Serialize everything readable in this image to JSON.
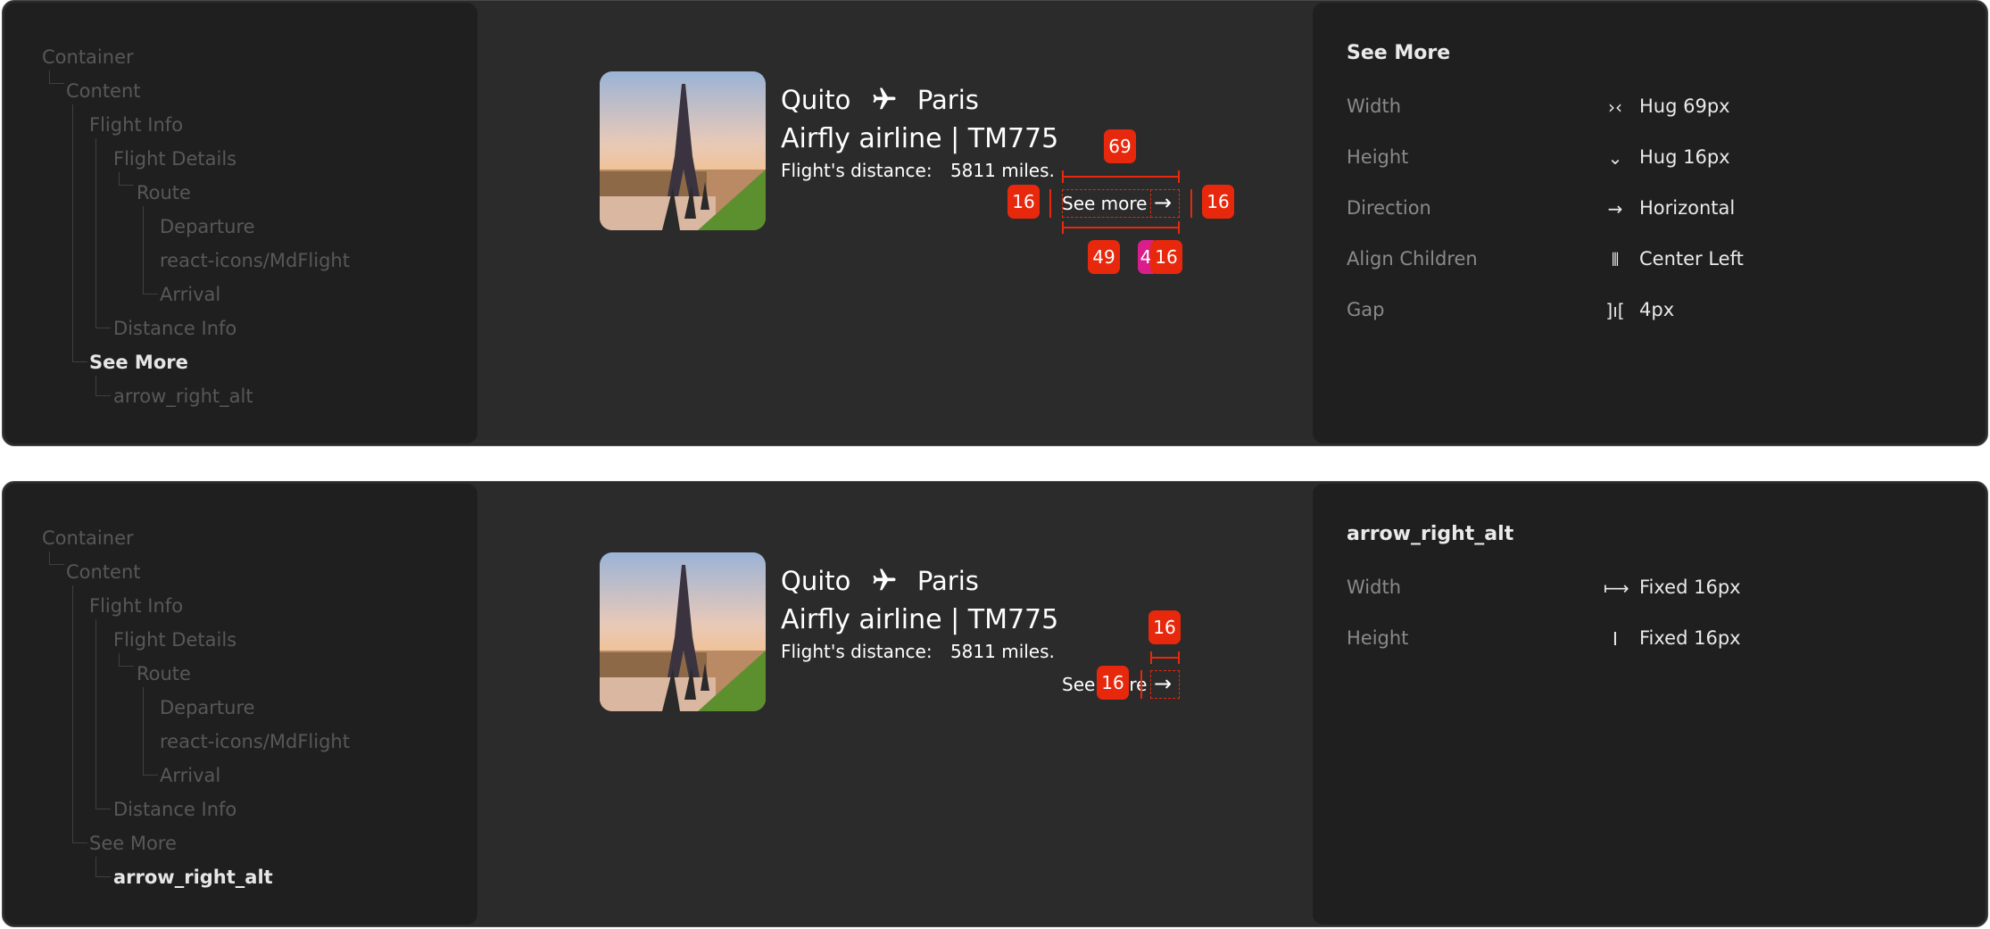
{
  "tree": {
    "items": [
      "Container",
      "Content",
      "Flight Info",
      "Flight Details",
      "Route",
      "Departure",
      "react-icons/MdFlight",
      "Arrival",
      "Distance Info",
      "See More",
      "arrow_right_alt"
    ]
  },
  "card": {
    "departure": "Quito",
    "arrival": "Paris",
    "airline": "Airfly airline | TM775",
    "distance_label": "Flight's distance:",
    "distance_value": "5811 miles.",
    "see_more": "See more",
    "flight_icon": "airplane-icon",
    "arrow_icon": "arrow-right-icon"
  },
  "panel1": {
    "selected": "See More",
    "measurements": {
      "width": "69",
      "left_padding": "16",
      "right_padding": "16",
      "text_width": "49",
      "gap": "4",
      "icon_width": "16"
    },
    "props": [
      {
        "label": "Width",
        "icon": "hug-horizontal-icon",
        "value": "Hug  69px"
      },
      {
        "label": "Height",
        "icon": "hug-vertical-icon",
        "value": "Hug  16px"
      },
      {
        "label": "Direction",
        "icon": "arrow-right-icon",
        "value": "Horizontal"
      },
      {
        "label": "Align Children",
        "icon": "align-center-left-icon",
        "value": "Center Left"
      },
      {
        "label": "Gap",
        "icon": "gap-icon",
        "value": "4px"
      }
    ]
  },
  "panel2": {
    "selected": "arrow_right_alt",
    "measurements": {
      "width": "16",
      "height": "16"
    },
    "props": [
      {
        "label": "Width",
        "icon": "fixed-width-icon",
        "value": "Fixed  16px"
      },
      {
        "label": "Height",
        "icon": "fixed-height-icon",
        "value": "Fixed  16px"
      }
    ]
  },
  "colors": {
    "accent": "#e8280c",
    "background": "#2b2b2b",
    "panel": "#1f1f1f",
    "gap_highlight": "#d91e8c"
  }
}
